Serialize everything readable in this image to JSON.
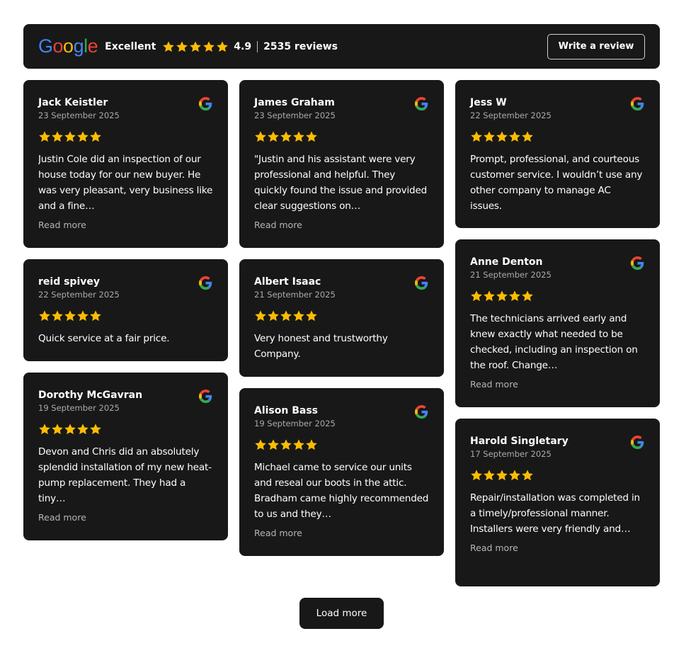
{
  "header": {
    "logo": "Google",
    "rating_word": "Excellent",
    "score": "4.9",
    "review_count": "2535 reviews",
    "write_review_label": "Write a review",
    "star_color": "#fbbc05"
  },
  "reviews": [
    {
      "name": "Jack Keistler",
      "date": "23 September 2025",
      "text": "Justin Cole did an inspection of our house today for our new buyer. He was very pleasant, very business like and a fine…",
      "read_more": "Read more"
    },
    {
      "name": "James Graham",
      "date": "23 September 2025",
      "text": "\"Justin and his assistant were very professional and helpful. They quickly found the issue and provided clear suggestions on…",
      "read_more": "Read more"
    },
    {
      "name": "Jess W",
      "date": "22 September 2025",
      "text": "Prompt, professional, and courteous customer service. I wouldn’t use any other company to manage AC issues."
    },
    {
      "name": "reid spivey",
      "date": "22 September 2025",
      "text": "Quick service at a fair price."
    },
    {
      "name": "Albert Isaac",
      "date": "21 September 2025",
      "text": "Very honest and trustworthy Company."
    },
    {
      "name": "Anne Denton",
      "date": "21 September 2025",
      "text": "The technicians arrived early and knew exactly what needed to be checked, including an inspection on the roof. Change…",
      "read_more": "Read more"
    },
    {
      "name": "Dorothy McGavran",
      "date": "19 September 2025",
      "text": "Devon and Chris did an absolutely splendid installation of my new heat-pump replacement. They had a tiny…",
      "read_more": "Read more"
    },
    {
      "name": "Alison Bass",
      "date": "19 September 2025",
      "text": "Michael came to service our units and reseal our boots in the attic. Bradham came highly recommended to us and they…",
      "read_more": "Read more"
    },
    {
      "name": "Harold Singletary",
      "date": "17 September 2025",
      "text": "Repair/installation was completed in a timely/professional manner. Installers were very friendly and…",
      "read_more": "Read more"
    }
  ],
  "load_more_label": "Load more"
}
